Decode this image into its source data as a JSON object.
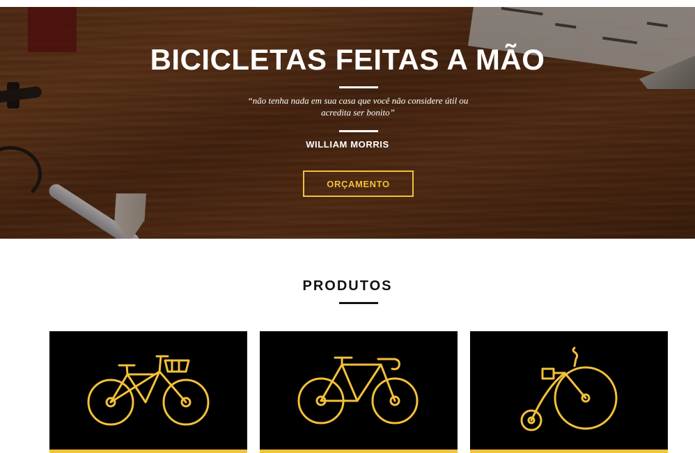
{
  "hero": {
    "title": "BICICLETAS FEITAS A MÃO",
    "quote": "“não tenha nada em sua casa que você não considere útil ou acredita ser bonito”",
    "author": "WILLIAM MORRIS",
    "cta_label": "ORÇAMENTO"
  },
  "products": {
    "title": "PRODUTOS",
    "items": [
      {
        "icon": "city-bike-icon"
      },
      {
        "icon": "road-bike-icon"
      },
      {
        "icon": "penny-farthing-icon"
      }
    ]
  },
  "colors": {
    "accent": "#f3c13a",
    "card_background": "#000000",
    "text_dark": "#111111",
    "hero_text": "#ffffff"
  }
}
